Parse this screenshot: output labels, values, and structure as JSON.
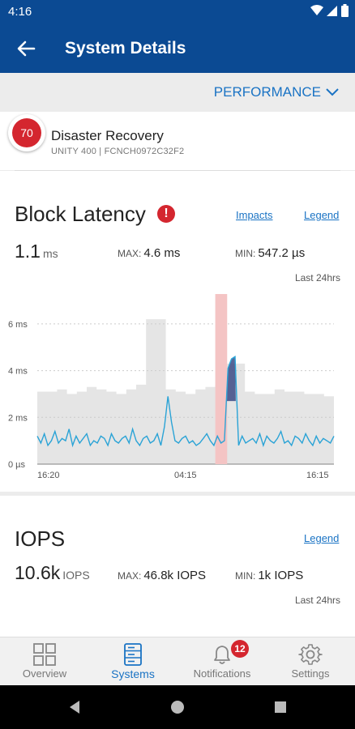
{
  "status_bar": {
    "time": "4:16"
  },
  "app_bar": {
    "title": "System Details",
    "back_icon": "arrow-left-icon"
  },
  "view_selector": {
    "label": "PERFORMANCE"
  },
  "system": {
    "health_score": "70",
    "name": "Disaster Recovery",
    "model_serial": "UNITY 400 | FCNCH0972C32F2"
  },
  "block_latency": {
    "title": "Block Latency",
    "alert_symbol": "!",
    "impacts_link": "Impacts",
    "legend_link": "Legend",
    "current_value": "1.1",
    "current_unit": "ms",
    "max_label": "MAX:",
    "max_value": "4.6 ms",
    "min_label": "MIN:",
    "min_value": "547.2 µs",
    "range_label": "Last 24hrs"
  },
  "chart_data": {
    "type": "line",
    "title": "Block Latency",
    "ylabel": "",
    "xlabel": "",
    "y_ticks": [
      "0 µs",
      "2 ms",
      "4 ms",
      "6 ms"
    ],
    "ylim": [
      0,
      7
    ],
    "x_ticks": [
      "16:20",
      "04:15",
      "16:15"
    ],
    "grid": true,
    "highlight_window": {
      "start_fraction": 0.6,
      "end_fraction": 0.64,
      "color": "#f4c4c4"
    },
    "colors": {
      "latency_line": "#2aa3d6",
      "background_band": "#e5e5e5",
      "impact_area": "#3c4a86"
    },
    "series": [
      {
        "values": [
          1.2,
          0.9,
          1.3,
          0.8,
          1.0,
          1.4,
          0.9,
          1.1,
          1.0,
          1.5,
          0.8,
          1.2,
          0.9,
          1.1,
          1.3,
          0.8,
          1.0,
          0.9,
          1.2,
          1.1,
          0.8,
          1.3,
          1.0,
          0.9,
          1.1,
          1.2,
          0.9,
          1.5,
          1.0,
          0.8,
          1.1,
          1.2,
          0.9,
          1.0,
          1.3,
          0.8,
          1.6,
          2.9,
          1.8,
          1.0,
          0.9,
          1.1,
          1.2,
          0.9,
          1.0,
          0.8,
          0.9,
          1.1,
          1.3,
          1.0,
          0.8,
          1.2,
          0.9,
          1.0,
          4.1,
          4.5,
          4.6,
          0.8,
          1.2,
          0.9,
          1.0,
          1.1,
          0.9,
          1.3,
          0.8,
          1.2,
          1.0,
          0.9,
          1.1,
          1.4,
          0.9,
          1.0,
          0.8,
          1.2,
          1.1,
          0.9,
          1.3,
          1.0,
          0.8,
          1.2,
          0.9,
          1.1,
          1.0,
          0.9,
          1.2
        ]
      }
    ]
  },
  "iops": {
    "title": "IOPS",
    "legend_link": "Legend",
    "current_value": "10.6k",
    "current_unit": "IOPS",
    "max_label": "MAX:",
    "max_value": "46.8k IOPS",
    "min_label": "MIN:",
    "min_value": "1k IOPS",
    "range_label": "Last 24hrs"
  },
  "bottom_nav": {
    "items": [
      {
        "label": "Overview",
        "icon": "overview-grid-icon"
      },
      {
        "label": "Systems",
        "icon": "systems-server-icon"
      },
      {
        "label": "Notifications",
        "icon": "bell-icon",
        "badge": "12"
      },
      {
        "label": "Settings",
        "icon": "gear-icon"
      }
    ]
  }
}
